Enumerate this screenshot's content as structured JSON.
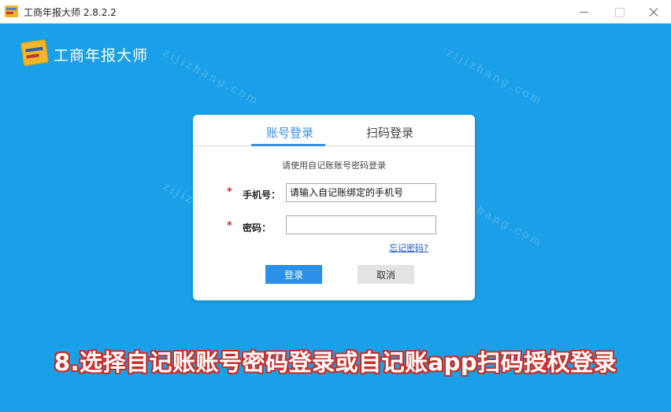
{
  "window": {
    "title": "工商年报大师 2.8.2.2"
  },
  "header": {
    "title": "工商年报大师",
    "logo_icon": "ledger-logo-icon"
  },
  "login": {
    "tabs": [
      {
        "label": "账号登录",
        "active": true
      },
      {
        "label": "扫码登录",
        "active": false
      }
    ],
    "hint": "请使用自记账账号密码登录",
    "phone_label": "手机号：",
    "phone_placeholder": "请输入自记账绑定的手机号",
    "password_label": "密码：",
    "required_mark": "*",
    "forgot_password": "忘记密码?",
    "login_button": "登录",
    "cancel_button": "取消"
  },
  "caption": "8.选择自记账账号密码登录或自记账app扫码授权登录",
  "watermark": "zijizhang.com",
  "colors": {
    "background": "#1aa0e8",
    "accent": "#3a8edc",
    "login_button": "#2a91e8",
    "caption_outline": "#c7302a"
  }
}
